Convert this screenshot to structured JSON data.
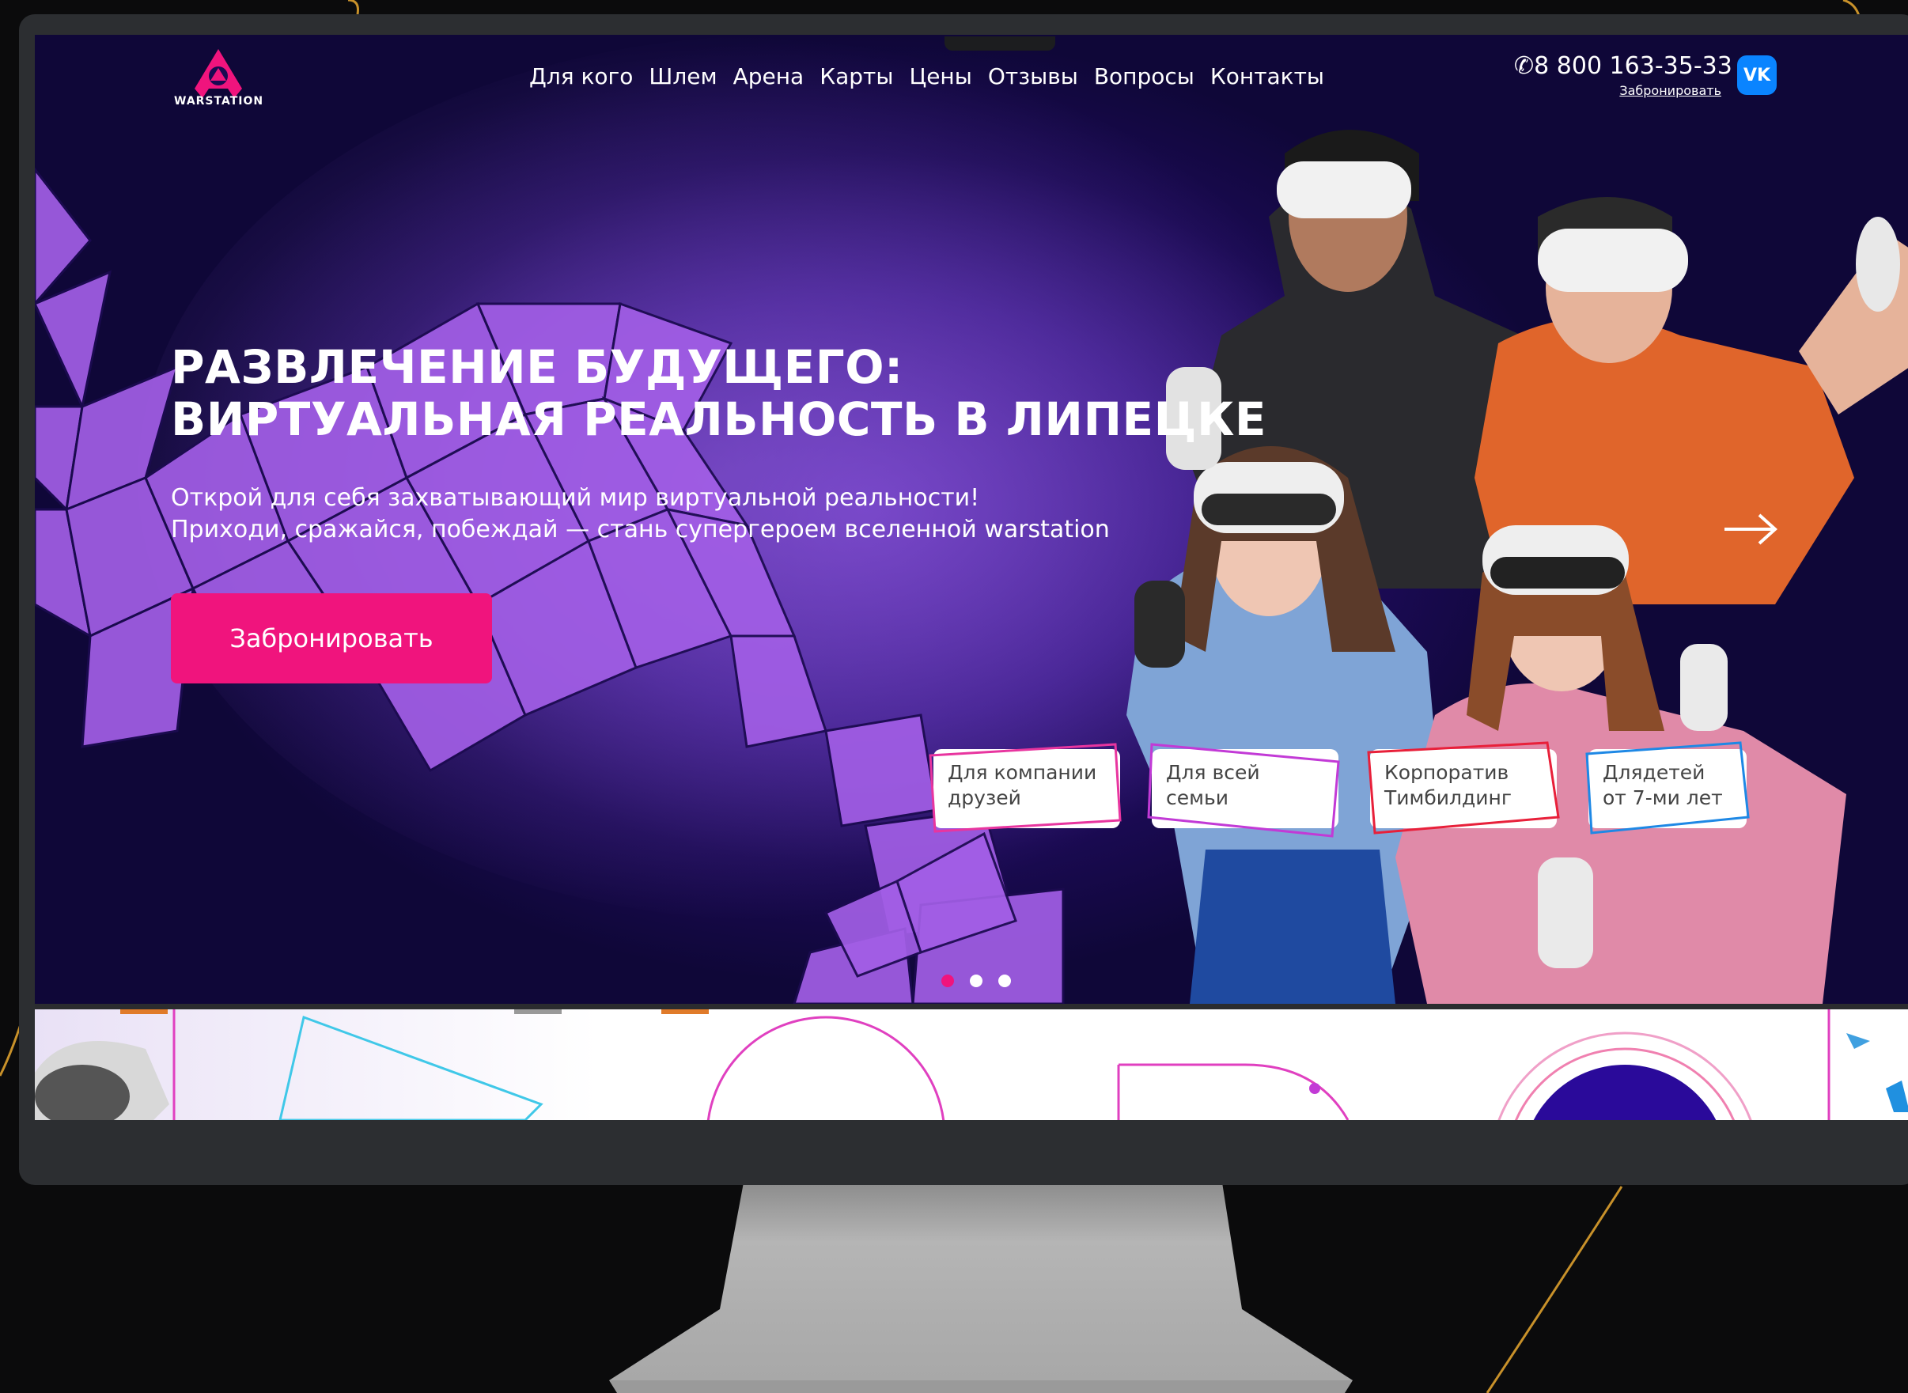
{
  "brand": {
    "logo_text": "WARSTATION",
    "accent_color": "#f0147d",
    "hero_bg_color": "#1a0a52",
    "vk_color": "#0a84ff"
  },
  "nav": {
    "items": [
      "Для кого",
      "Шлем",
      "Арена",
      "Карты",
      "Цены",
      "Отзывы",
      "Вопросы",
      "Контакты"
    ]
  },
  "header": {
    "phone": "8 800 163-35-33",
    "book_link": "Забронировать",
    "vk_label": "VK"
  },
  "hero": {
    "headline_line1": "РАЗВЛЕЧЕНИЕ БУДУЩЕГО:",
    "headline_line2": "ВИРТУАЛЬНАЯ РЕАЛЬНОСТЬ В ЛИПЕЦКЕ",
    "sub_line1": "Открой для себя захватывающий мир виртуальной реальности!",
    "sub_line2": "Приходи, сражайся, побеждай — стань супергероем вселенной warstation",
    "cta_label": "Забронировать",
    "tags": [
      {
        "line1": "Для компании",
        "line2": "друзей",
        "border": "#e8359f"
      },
      {
        "line1": "Для всей",
        "line2": "семьи",
        "border": "#c23ad6"
      },
      {
        "line1": "Корпоратив",
        "line2": "Тимбилдинг",
        "border": "#e8203a"
      },
      {
        "line1": "Длядетей",
        "line2": "от 7-ми лет",
        "border": "#1e88e5"
      }
    ],
    "slides_total": 3,
    "active_slide": 1
  }
}
